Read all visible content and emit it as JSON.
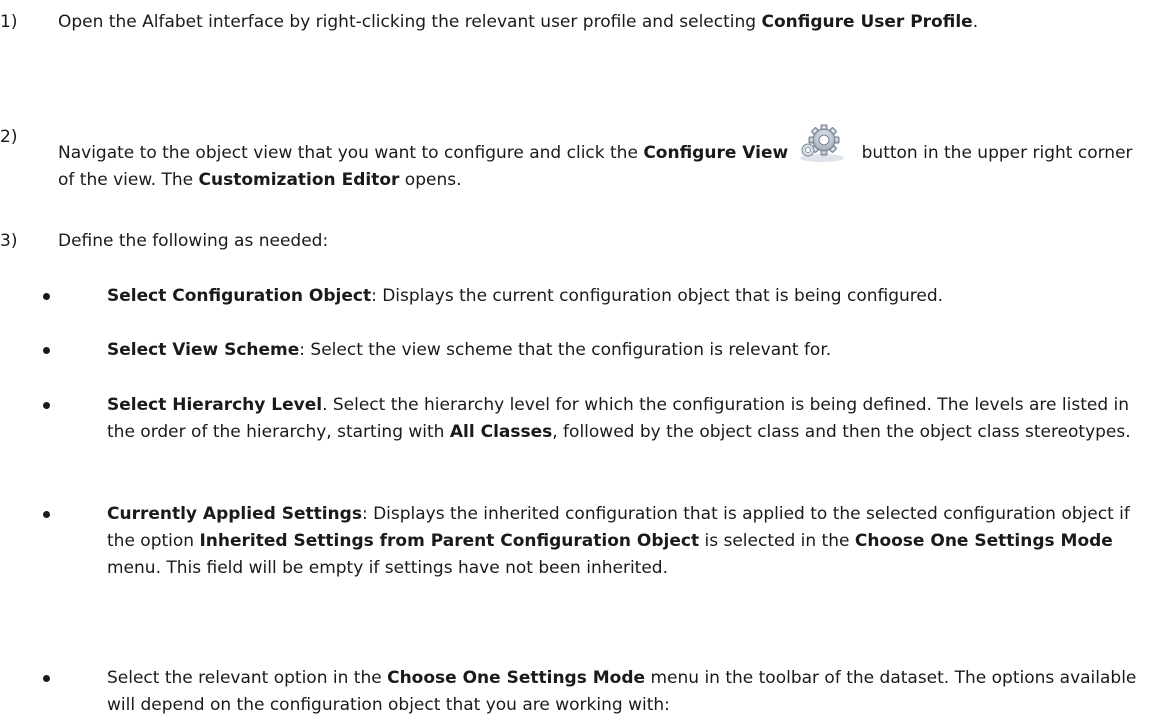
{
  "steps": [
    {
      "number": "1)",
      "text_1": "Open the Alfabet interface by right-clicking the relevant user profile and selecting ",
      "bold_1": "Configure User Profile",
      "text_2": "."
    },
    {
      "number": "2)",
      "text_1": "Navigate to the object view that you want to configure and click the ",
      "bold_1": "Configure View",
      "icon": "gear-icon",
      "text_2": " button in the upper right corner of the view. The ",
      "bold_2": "Customization Editor",
      "text_3": " opens."
    },
    {
      "number": "3)",
      "text_1": "Define the following as needed:"
    }
  ],
  "bullets": [
    {
      "bold_1": "Select Configuration Object",
      "text_1": ": Displays the current configuration object that is being configured."
    },
    {
      "bold_1": "Select View Scheme",
      "text_1": ": Select the view scheme that the configuration is relevant for."
    },
    {
      "bold_1": "Select Hierarchy Level",
      "text_1": ". Select the hierarchy level for which the configuration is being defined. The levels are listed in the order of the hierarchy, starting with ",
      "bold_2": "All Classes",
      "text_2": ", followed by the object class and then the object class stereotypes."
    },
    {
      "bold_1": "Currently Applied Settings",
      "text_1": ": Displays the inherited configuration that is applied to the selected configuration object if the option ",
      "bold_2": "Inherited Settings from Parent Configuration Object",
      "text_2": " is selected in the ",
      "bold_3": "Choose One Settings Mode",
      "text_3": " menu. This field will be empty if settings have not been inherited."
    },
    {
      "text_1": "Select the relevant option in the ",
      "bold_1": "Choose One Settings Mode",
      "text_2": " menu in the toolbar of the dataset. The options available will depend on the configuration object that you are working with:"
    }
  ]
}
